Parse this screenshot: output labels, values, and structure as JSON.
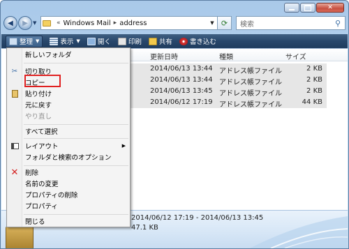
{
  "address": {
    "crumb_sep": "«",
    "crumbs": [
      "Windows Mail",
      "address"
    ],
    "crumb_arrow": "▸"
  },
  "search": {
    "placeholder": "検索"
  },
  "toolbar": {
    "organize": "整理",
    "views": "表示",
    "open": "開く",
    "print": "印刷",
    "share": "共有",
    "burn": "書き込む"
  },
  "columns": {
    "modified": "更新日時",
    "type": "種類",
    "size": "サイズ"
  },
  "files": [
    {
      "modified": "2014/06/13 13:44",
      "type": "アドレス帳ファイル",
      "size": "2 KB"
    },
    {
      "modified": "2014/06/13 13:44",
      "type": "アドレス帳ファイル",
      "size": "2 KB"
    },
    {
      "modified": "2014/06/13 13:45",
      "type": "アドレス帳ファイル",
      "size": "2 KB"
    },
    {
      "modified": "2014/06/12 17:19",
      "type": "アドレス帳ファイル",
      "size": "44 KB"
    }
  ],
  "details": {
    "date_range": "2014/06/12 17:19 - 2014/06/13 13:45",
    "total_size": "47.1 KB"
  },
  "menu": {
    "new_folder": "新しいフォルダ",
    "cut": "切り取り",
    "copy": "コピー",
    "paste": "貼り付け",
    "undo": "元に戻す",
    "redo": "やり直し",
    "select_all": "すべて選択",
    "layout": "レイアウト",
    "folder_options": "フォルダと検索のオプション",
    "delete": "削除",
    "rename": "名前の変更",
    "remove_properties": "プロパティの削除",
    "properties": "プロパティ",
    "close": "閉じる"
  },
  "colors": {
    "highlight_box": "#e02020",
    "toolbar": "#28476b"
  },
  "icons": {
    "back": "arrow-left-icon",
    "forward": "arrow-right-icon",
    "refresh": "refresh-icon",
    "search": "magnifier-icon",
    "cut": "scissors-icon",
    "paste": "clipboard-icon",
    "layout": "layout-icon",
    "delete": "red-x-icon"
  }
}
